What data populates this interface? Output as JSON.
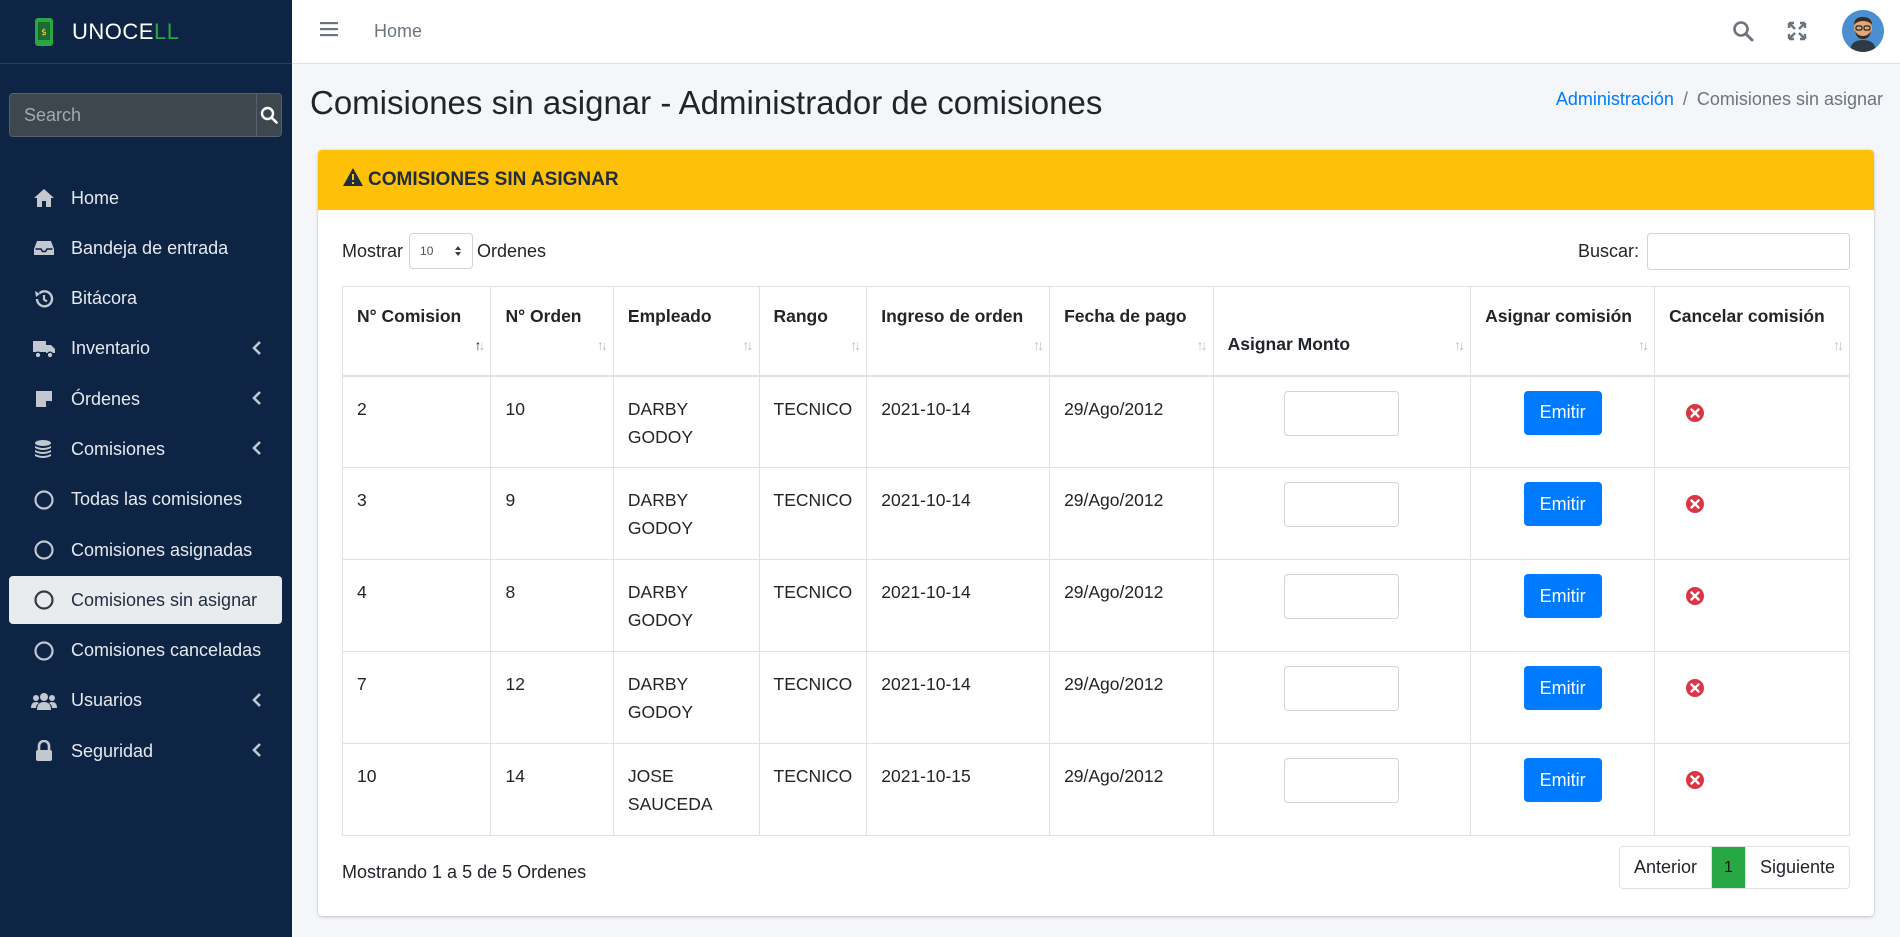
{
  "brand": {
    "name_main": "UNOCE",
    "name_accent": "LL"
  },
  "sidebar": {
    "search_placeholder": "Search",
    "items": [
      {
        "label": "Home",
        "icon": "home-icon"
      },
      {
        "label": "Bandeja de entrada",
        "icon": "inbox-icon"
      },
      {
        "label": "Bitácora",
        "icon": "history-icon"
      },
      {
        "label": "Inventario",
        "icon": "truck-icon"
      },
      {
        "label": "Órdenes",
        "icon": "note-icon"
      },
      {
        "label": "Comisiones",
        "icon": "coins-icon"
      },
      {
        "label": "Todas las comisiones",
        "icon": "circle-icon"
      },
      {
        "label": "Comisiones asignadas",
        "icon": "circle-icon"
      },
      {
        "label": "Comisiones sin asignar",
        "icon": "circle-icon"
      },
      {
        "label": "Comisiones canceladas",
        "icon": "circle-icon"
      },
      {
        "label": "Usuarios",
        "icon": "users-icon"
      },
      {
        "label": "Seguridad",
        "icon": "lock-icon"
      }
    ]
  },
  "topbar": {
    "home_link": "Home"
  },
  "header": {
    "title": "Comisiones sin asignar - Administrador de comisiones",
    "breadcrumb": [
      "Administración",
      "Comisiones sin asignar"
    ]
  },
  "card": {
    "title": "COMISIONES SIN ASIGNAR",
    "length_prefix": "Mostrar",
    "length_value": "10",
    "length_suffix": "Ordenes",
    "filter_label": "Buscar:",
    "columns": [
      "N° Comision",
      "N° Orden",
      "Empleado",
      "Rango",
      "Ingreso de orden",
      "Fecha de pago",
      "Asignar Monto",
      "Asignar comisión",
      "Cancelar comisión"
    ],
    "emit_label": "Emitir",
    "rows": [
      {
        "comision": "2",
        "orden": "10",
        "empleado": "DARBY GODOY",
        "rango": "TECNICO",
        "ingreso": "2021-10-14",
        "pago": "29/Ago/2012"
      },
      {
        "comision": "3",
        "orden": "9",
        "empleado": "DARBY GODOY",
        "rango": "TECNICO",
        "ingreso": "2021-10-14",
        "pago": "29/Ago/2012"
      },
      {
        "comision": "4",
        "orden": "8",
        "empleado": "DARBY GODOY",
        "rango": "TECNICO",
        "ingreso": "2021-10-14",
        "pago": "29/Ago/2012"
      },
      {
        "comision": "7",
        "orden": "12",
        "empleado": "DARBY GODOY",
        "rango": "TECNICO",
        "ingreso": "2021-10-14",
        "pago": "29/Ago/2012"
      },
      {
        "comision": "10",
        "orden": "14",
        "empleado": "JOSE SAUCEDA",
        "rango": "TECNICO",
        "ingreso": "2021-10-15",
        "pago": "29/Ago/2012"
      }
    ],
    "info": "Mostrando 1 a 5 de 5 Ordenes",
    "pager": {
      "prev": "Anterior",
      "page": "1",
      "next": "Siguiente"
    }
  },
  "colors": {
    "sidebar": "#0d2444",
    "header_warning": "#ffc107",
    "primary": "#007bff",
    "success": "#28a745",
    "danger": "#dc3545"
  }
}
